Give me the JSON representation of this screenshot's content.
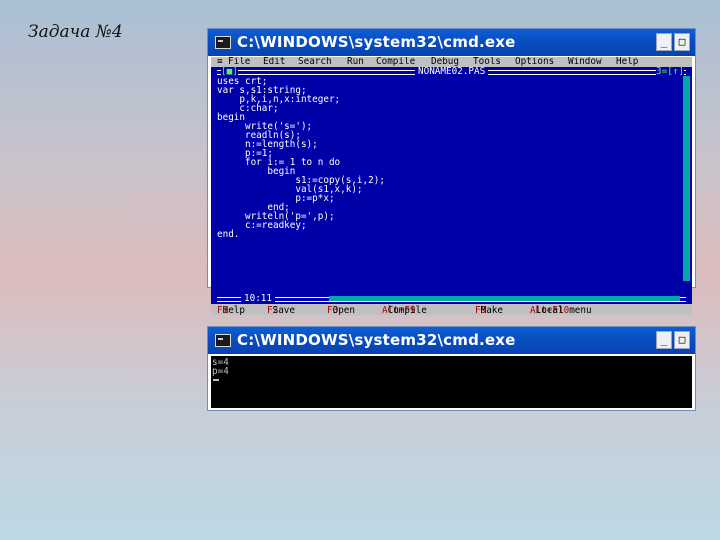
{
  "slide": {
    "title": "Задача №4"
  },
  "ide_window": {
    "title": "C:\\WINDOWS\\system32\\cmd.exe",
    "controls": {
      "minimize": "_",
      "maximize": "□",
      "close": "×"
    },
    "menu": [
      "File",
      "Edit",
      "Search",
      "Run",
      "Compile",
      "Debug",
      "Tools",
      "Options",
      "Window",
      "Help"
    ],
    "editor": {
      "close_box": "[■]",
      "file_name": "NONAME02.PAS",
      "window_info": "3=[↑]",
      "cursor_position": "10:11",
      "code_lines": [
        "uses crt;",
        "var s,s1:string;",
        "    p,k,i,n,x:integer;",
        "    c:char;",
        "begin",
        "     write('s=');",
        "     readln(s);",
        "     n:=length(s);",
        "     p:=1;",
        "     for i:= 1 to n do",
        "         begin",
        "              s1:=copy(s,i,2);",
        "              val(s1,x,k);",
        "              p:=p*x;",
        "         end;",
        "     writeln('p=',p);",
        "     c:=readkey;",
        "end."
      ]
    },
    "status_bar": [
      {
        "key": "F1",
        "label": "Help"
      },
      {
        "key": "F2",
        "label": "Save"
      },
      {
        "key": "F3",
        "label": "Open"
      },
      {
        "key": "Alt+F9",
        "label": "Compile"
      },
      {
        "key": "F9",
        "label": "Make"
      },
      {
        "key": "Alt+F10",
        "label": "Local menu"
      }
    ]
  },
  "console_window": {
    "title": "C:\\WINDOWS\\system32\\cmd.exe",
    "controls": {
      "minimize": "_",
      "maximize": "□",
      "close": "×"
    },
    "output_lines": [
      "s=4",
      "p=4"
    ]
  }
}
